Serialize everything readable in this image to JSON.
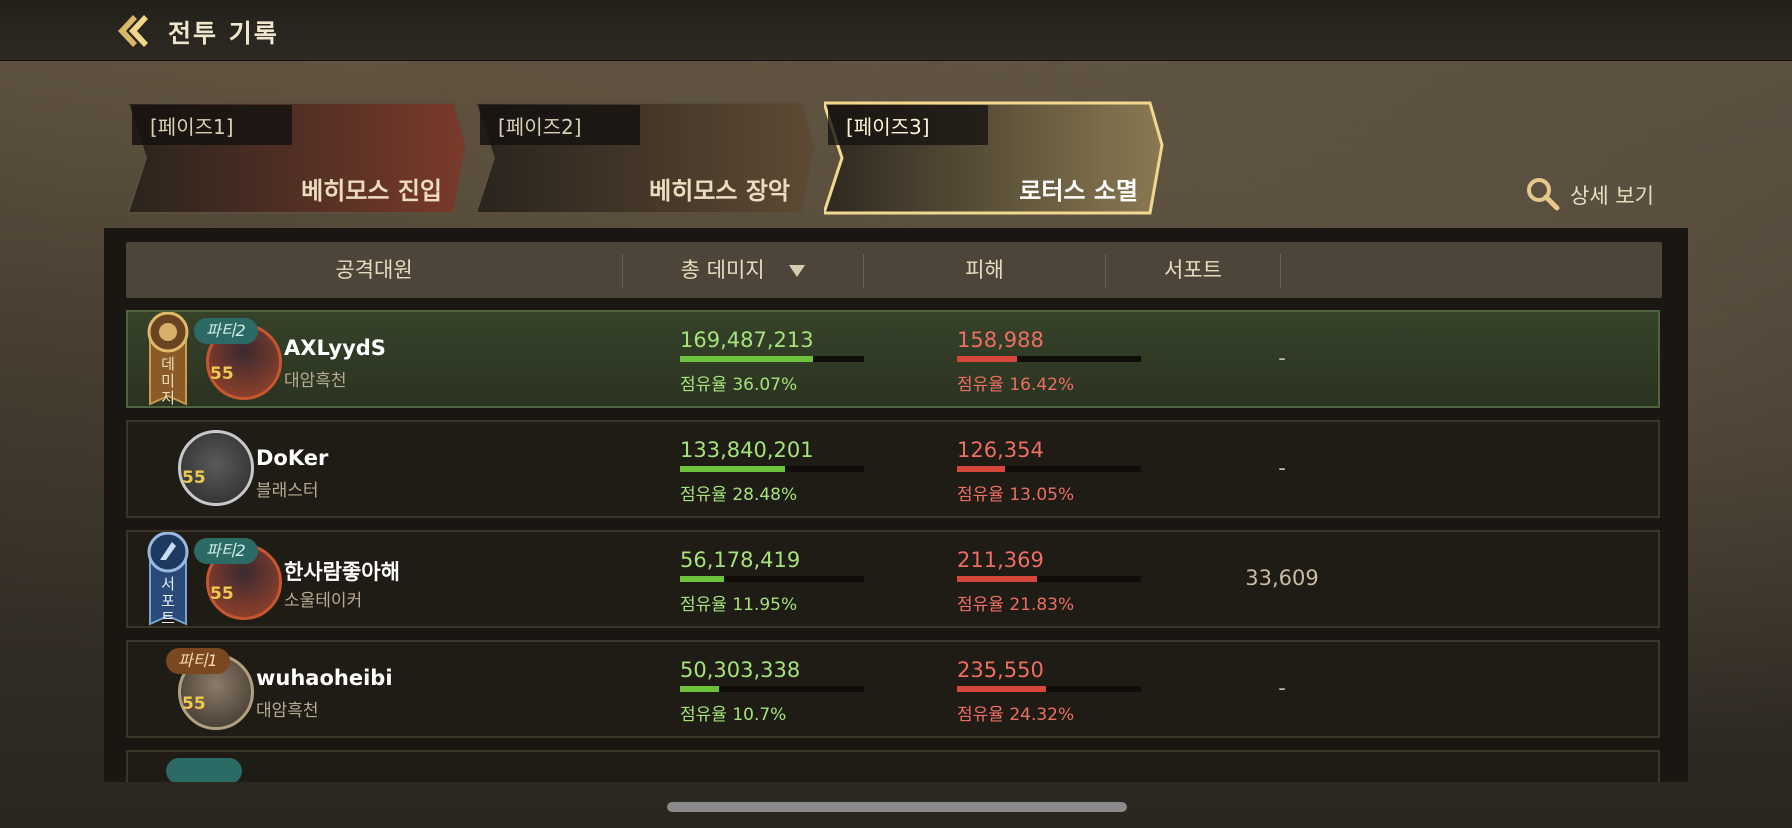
{
  "header": {
    "title": "전투 기록"
  },
  "phases": [
    {
      "label": "[페이즈1]",
      "name": "베히모스 진입",
      "active": false
    },
    {
      "label": "[페이즈2]",
      "name": "베히모스 장악",
      "active": false
    },
    {
      "label": "[페이즈3]",
      "name": "로터스 소멸",
      "active": true
    }
  ],
  "detail_button": {
    "label": "상세 보기",
    "icon": "search-icon"
  },
  "table": {
    "columns": [
      "공격대원",
      "총 데미지",
      "피해",
      "서포트"
    ],
    "sort_column": "총 데미지",
    "sort_icon": "triangle-down-icon",
    "rows": [
      {
        "party": "파티2",
        "level": "55",
        "name": "AXLyydS",
        "class": "대암흑천",
        "damage": "169,487,213",
        "damage_share": "점유율 36.07%",
        "damage_fraction": 0.3607,
        "hit": "158,988",
        "hit_share": "점유율 16.42%",
        "hit_fraction": 0.1642,
        "support": "-",
        "award": "데미지",
        "highlight": true
      },
      {
        "party": "",
        "level": "55",
        "name": "DoKer",
        "class": "블래스터",
        "damage": "133,840,201",
        "damage_share": "점유율 28.48%",
        "damage_fraction": 0.2848,
        "hit": "126,354",
        "hit_share": "점유율 13.05%",
        "hit_fraction": 0.1305,
        "support": "-",
        "award": "",
        "highlight": false
      },
      {
        "party": "파티2",
        "level": "55",
        "name": "한사람좋아해",
        "class": "소울테이커",
        "damage": "56,178,419",
        "damage_share": "점유율 11.95%",
        "damage_fraction": 0.1195,
        "hit": "211,369",
        "hit_share": "점유율 21.83%",
        "hit_fraction": 0.2183,
        "support": "33,609",
        "award": "서포트",
        "highlight": false
      },
      {
        "party": "파티1",
        "level": "55",
        "name": "wuhaoheibi",
        "class": "대암흑천",
        "damage": "50,303,338",
        "damage_share": "점유율 10.7%",
        "damage_fraction": 0.107,
        "hit": "235,550",
        "hit_share": "점유율 24.32%",
        "hit_fraction": 0.2432,
        "support": "-",
        "award": "",
        "highlight": false
      }
    ]
  },
  "colors": {
    "damage": "#a6e27a",
    "hit": "#ec6f62",
    "accent": "#e6c98a"
  }
}
